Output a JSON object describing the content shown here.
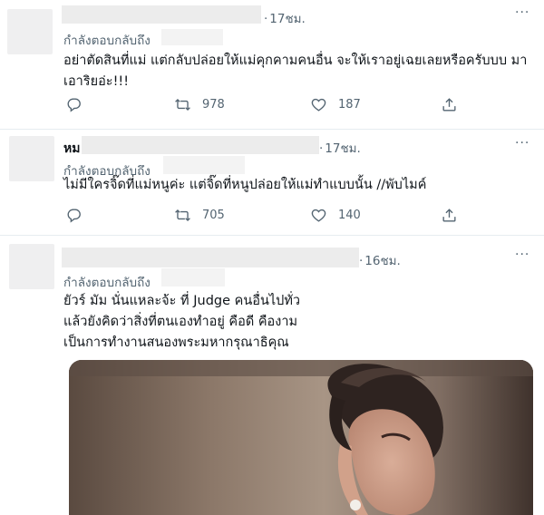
{
  "tweets": [
    {
      "time": "17ชม.",
      "replying_label": "กำลังตอบกลับถึง",
      "text_lines": [
        "อย่าตัดสินที่แม่ แต่กลับปล่อยให้แม่คุกคามคนอื่น จะให้เราอยู่เฉยเลยหรือครับบบ มา",
        "เอาริยอ่ะ!!!"
      ],
      "retweets": "978",
      "likes": "187"
    },
    {
      "name_prefix": "หม",
      "time": "17ชม.",
      "replying_label": "กำลังตอบกลับถึง",
      "text_lines": [
        "ไม่มีใครจิ๊ดที่แม่หนูค่ะ แต่จิ๊ดที่หนูปล่อยให้แม่ทำแบบนั้น //พับไมค์"
      ],
      "retweets": "705",
      "likes": "140"
    },
    {
      "time": "16ชม.",
      "replying_label": "กำลังตอบกลับถึง",
      "text_lines": [
        "ยัวร์ มัม นั่นแหละจ้ะ ที่ Judge คนอื่นไปทั่ว",
        "แล้วยังคิดว่าสิ่งที่ตนเองทำอยู่ คือดี คืองาม",
        "เป็นการทำงานสนองพระมหากรุณาธิคุณ"
      ]
    }
  ],
  "more_glyph": "···",
  "icons": {
    "reply": "reply-icon",
    "retweet": "retweet-icon",
    "like": "heart-icon",
    "share": "share-icon",
    "more": "more-icon"
  }
}
